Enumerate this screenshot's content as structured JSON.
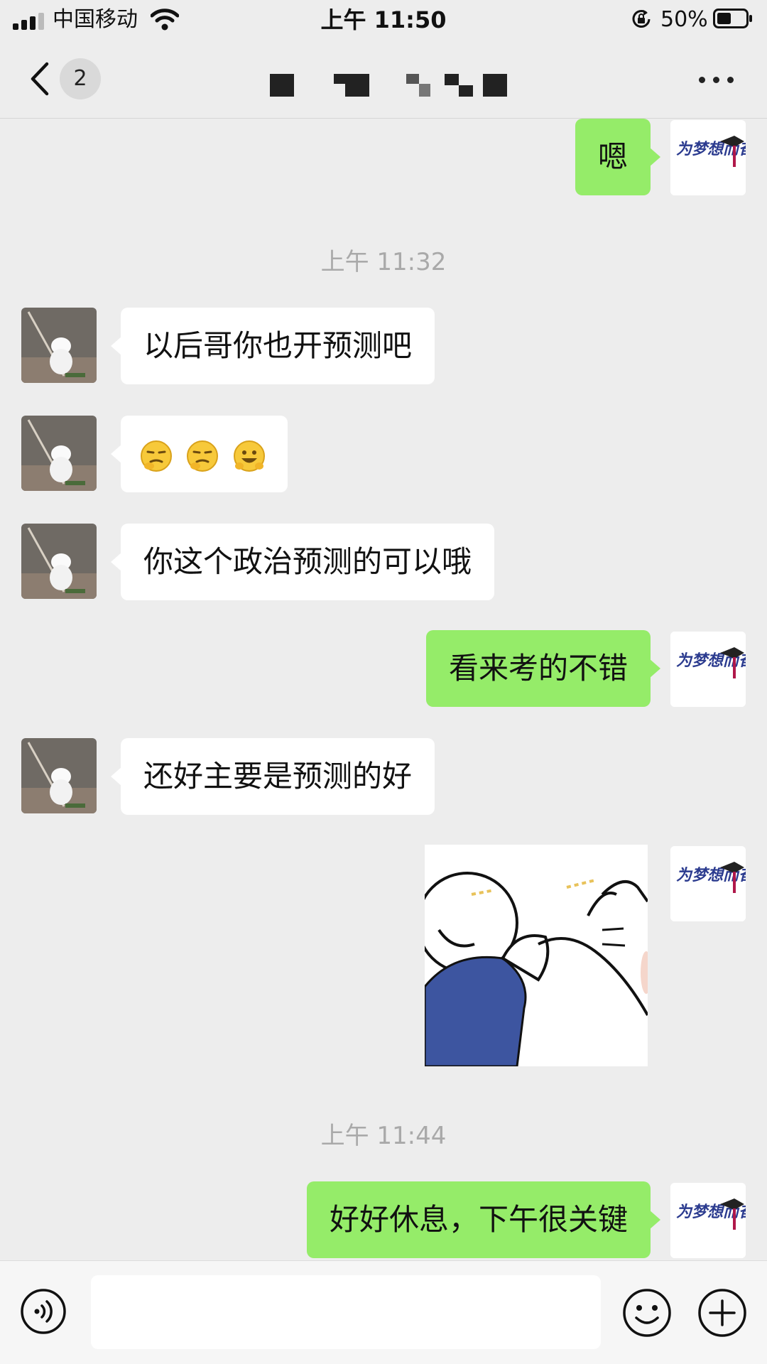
{
  "status_bar": {
    "carrier": "中国移动",
    "time": "上午 11:50",
    "battery_percent": "50%",
    "battery_level": 0.5
  },
  "nav": {
    "unread_count": "2",
    "title_obscured": true
  },
  "messages": [
    {
      "side": "mine",
      "text": "嗯"
    },
    {
      "type": "time",
      "text": "上午 11:32"
    },
    {
      "side": "other",
      "text": "以后哥你也开预测吧"
    },
    {
      "side": "other",
      "type": "emoji",
      "icons": [
        "smirk-emoji",
        "smirk-emoji",
        "grin-emoji"
      ]
    },
    {
      "side": "other",
      "text": "你这个政治预测的可以哦"
    },
    {
      "side": "mine",
      "text": "看来考的不错"
    },
    {
      "side": "other",
      "text": "还好主要是预测的好"
    },
    {
      "side": "mine",
      "type": "sticker",
      "sticker": "fist-bump-sticker"
    },
    {
      "type": "time",
      "text": "上午 11:44"
    },
    {
      "side": "mine",
      "text": "好好休息，下午很关键"
    }
  ],
  "my_avatar": {
    "text": "为梦想而奋斗"
  },
  "input": {
    "value": "",
    "placeholder": ""
  },
  "colors": {
    "background": "#ededed",
    "my_bubble": "#95ec69",
    "other_bubble": "#ffffff",
    "sticker_blue": "#3d55a0",
    "avatar_text": "#2b3b8f",
    "avatar_accent": "#b0184a"
  }
}
